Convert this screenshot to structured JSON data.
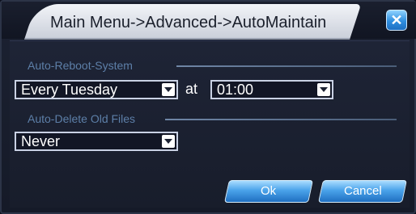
{
  "window": {
    "title": "Main Menu->Advanced->AutoMaintain",
    "close_glyph": "✕"
  },
  "auto_reboot": {
    "section_label": "Auto-Reboot-System",
    "day_value": "Every Tuesday",
    "at_label": "at",
    "time_value": "01:00"
  },
  "auto_delete": {
    "section_label": "Auto-Delete Old Files",
    "value": "Never"
  },
  "buttons": {
    "ok_label": "Ok",
    "cancel_label": "Cancel"
  },
  "colors": {
    "accent_blue": "#2f8fe0",
    "section_label": "#5d7fa8",
    "background": "#1a1f2e"
  }
}
